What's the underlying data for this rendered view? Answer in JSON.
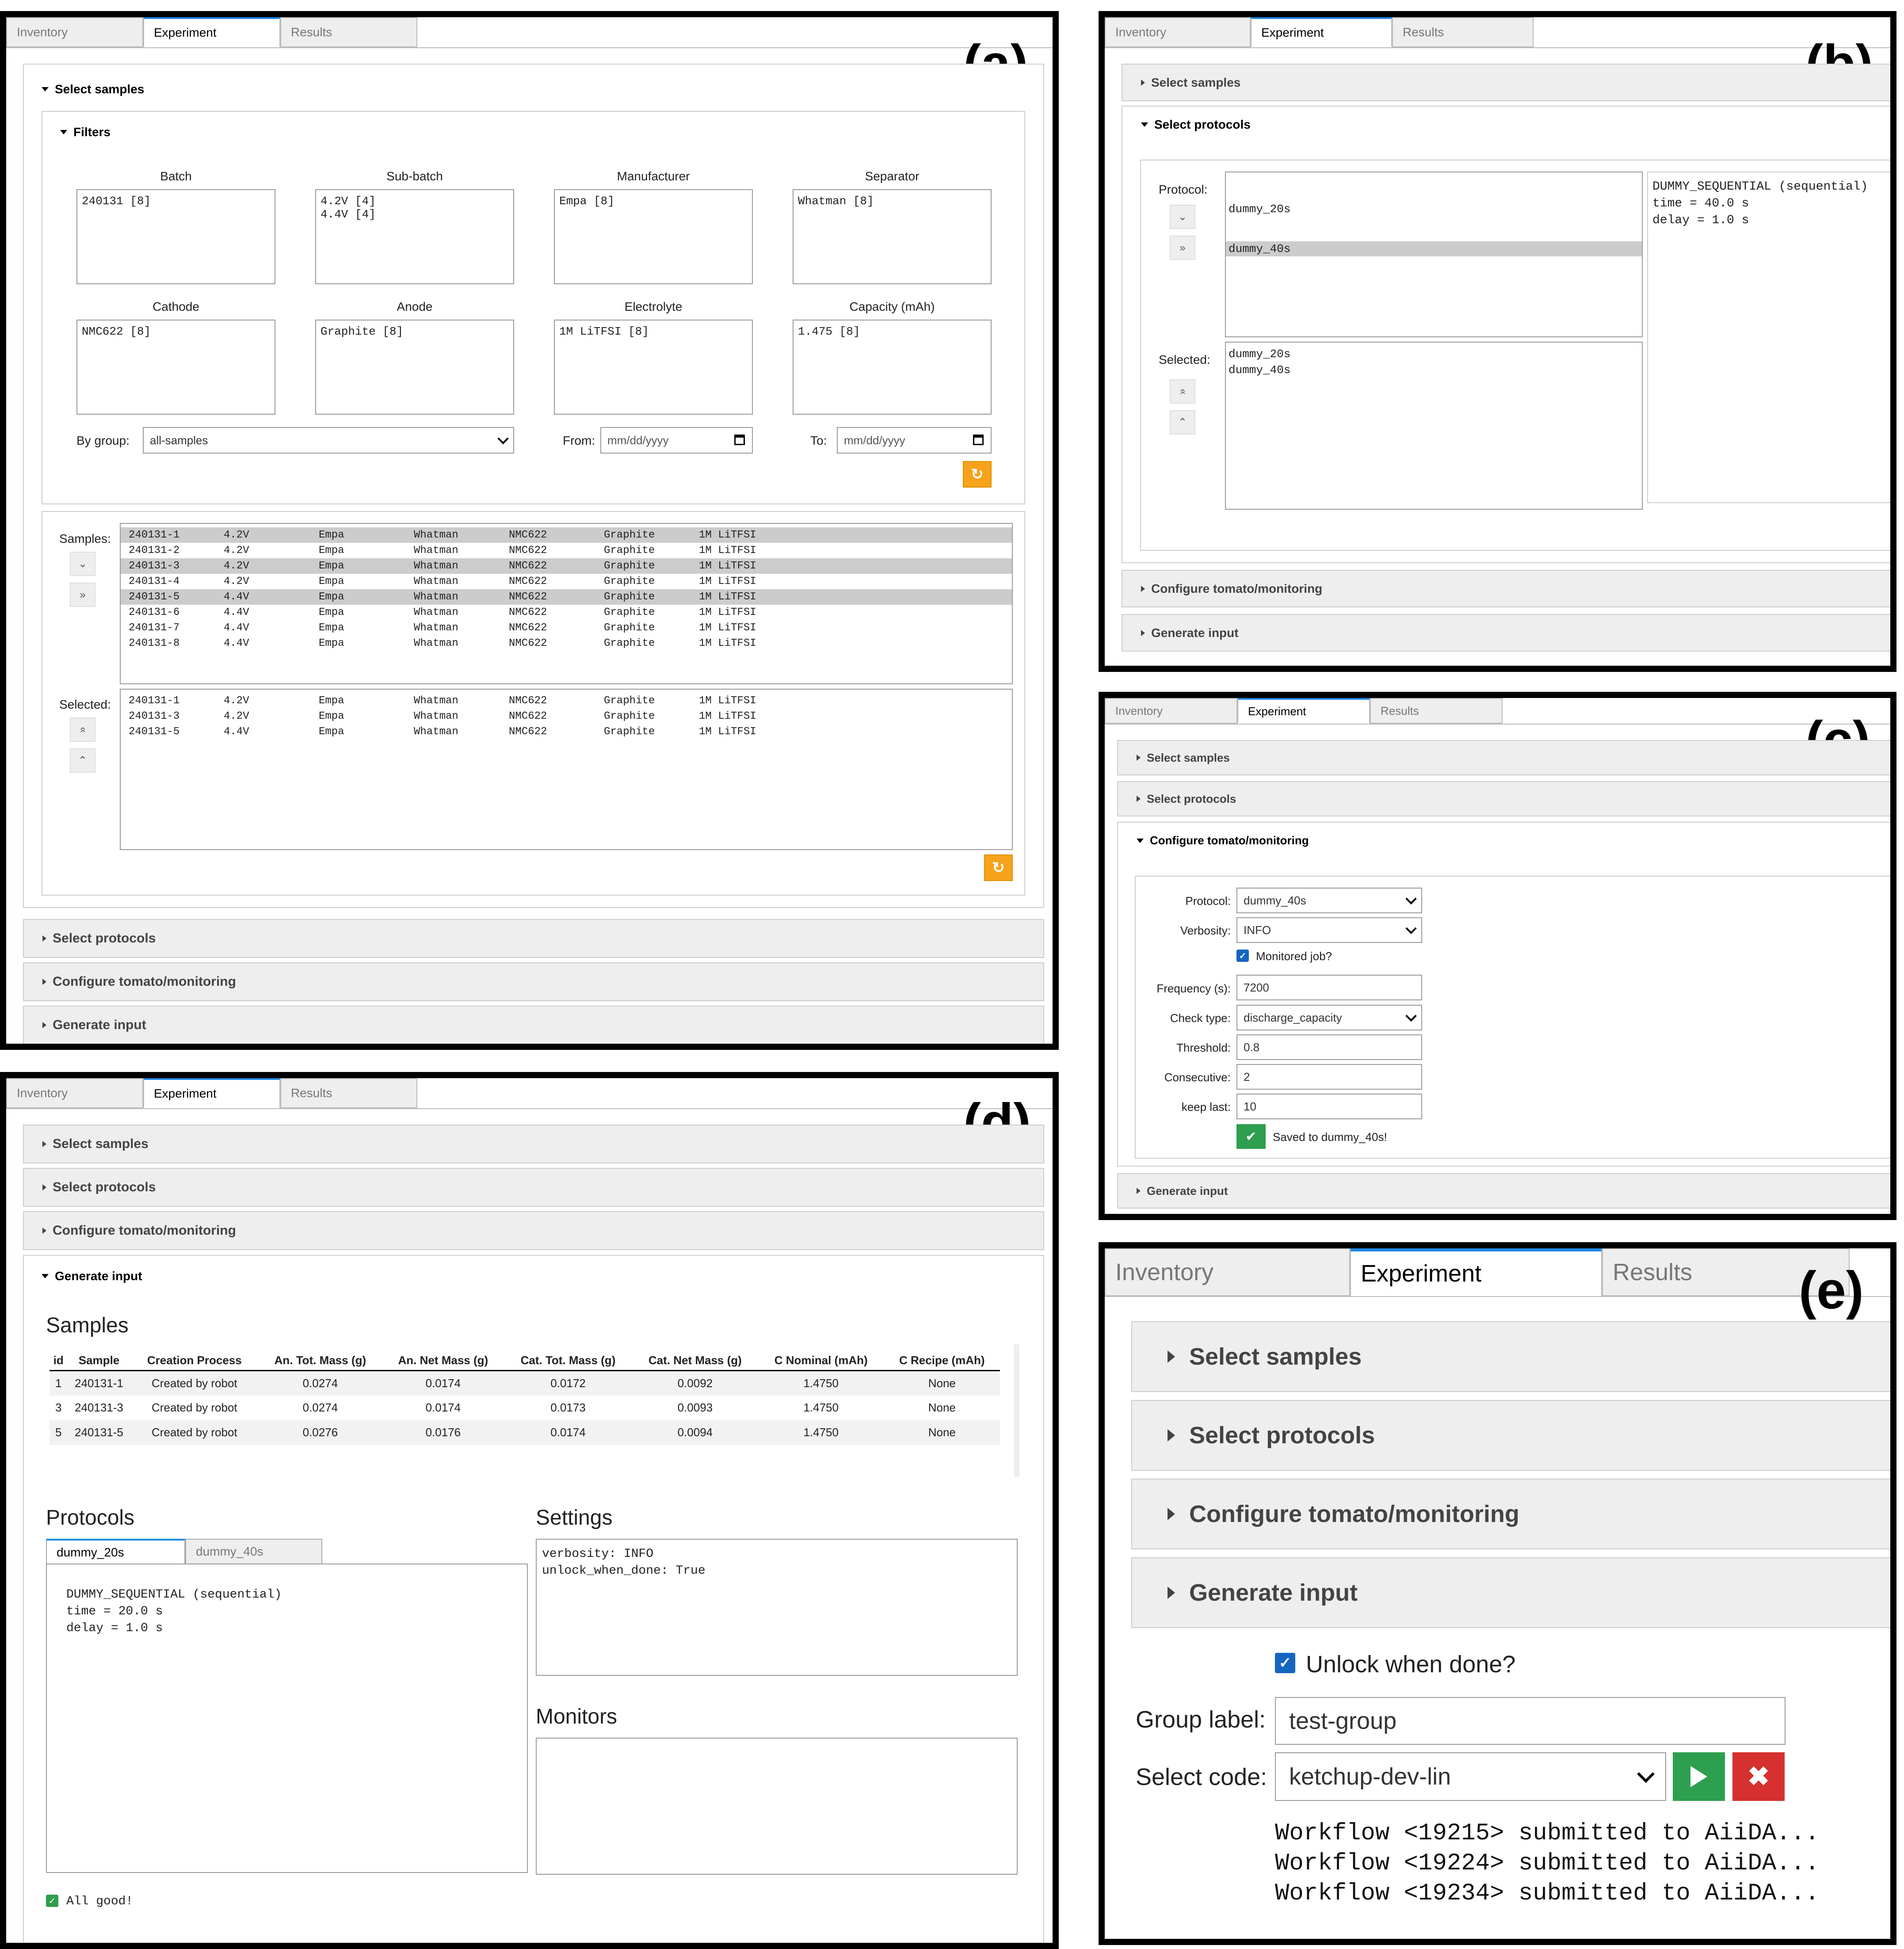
{
  "tabs": {
    "inventory": "Inventory",
    "experiment": "Experiment",
    "results": "Results"
  },
  "panels": {
    "a": "(a)",
    "b": "(b)",
    "c": "(c)",
    "d": "(d)",
    "e": "(e)"
  },
  "accordions": {
    "select_samples": "Select samples",
    "filters": "Filters",
    "select_protocols": "Select protocols",
    "configure": "Configure tomato/monitoring",
    "generate": "Generate input"
  },
  "filters": {
    "batch": {
      "label": "Batch",
      "values": "240131 [8]"
    },
    "subbatch": {
      "label": "Sub-batch",
      "values": "4.2V [4]\n4.4V [4]"
    },
    "manufacturer": {
      "label": "Manufacturer",
      "values": "Empa [8]"
    },
    "separator": {
      "label": "Separator",
      "values": "Whatman [8]"
    },
    "cathode": {
      "label": "Cathode",
      "values": "NMC622 [8]"
    },
    "anode": {
      "label": "Anode",
      "values": "Graphite [8]"
    },
    "electrolyte": {
      "label": "Electrolyte",
      "values": "1M LiTFSI [8]"
    },
    "capacity": {
      "label": "Capacity (mAh)",
      "values": "1.475 [8]"
    },
    "by_group_label": "By group:",
    "by_group_value": "all-samples",
    "from_label": "From:",
    "to_label": "To:",
    "date_placeholder": "mm/dd/yyyy"
  },
  "samples": {
    "samples_label": "Samples:",
    "selected_label": "Selected:",
    "rows": [
      [
        "240131-1",
        "4.2V",
        "Empa",
        "Whatman",
        "NMC622",
        "Graphite",
        "1M LiTFSI"
      ],
      [
        "240131-2",
        "4.2V",
        "Empa",
        "Whatman",
        "NMC622",
        "Graphite",
        "1M LiTFSI"
      ],
      [
        "240131-3",
        "4.2V",
        "Empa",
        "Whatman",
        "NMC622",
        "Graphite",
        "1M LiTFSI"
      ],
      [
        "240131-4",
        "4.2V",
        "Empa",
        "Whatman",
        "NMC622",
        "Graphite",
        "1M LiTFSI"
      ],
      [
        "240131-5",
        "4.4V",
        "Empa",
        "Whatman",
        "NMC622",
        "Graphite",
        "1M LiTFSI"
      ],
      [
        "240131-6",
        "4.4V",
        "Empa",
        "Whatman",
        "NMC622",
        "Graphite",
        "1M LiTFSI"
      ],
      [
        "240131-7",
        "4.4V",
        "Empa",
        "Whatman",
        "NMC622",
        "Graphite",
        "1M LiTFSI"
      ],
      [
        "240131-8",
        "4.4V",
        "Empa",
        "Whatman",
        "NMC622",
        "Graphite",
        "1M LiTFSI"
      ]
    ],
    "highlighted": [
      0,
      2,
      4
    ],
    "selected_rows": [
      [
        "240131-1",
        "4.2V",
        "Empa",
        "Whatman",
        "NMC622",
        "Graphite",
        "1M LiTFSI"
      ],
      [
        "240131-3",
        "4.2V",
        "Empa",
        "Whatman",
        "NMC622",
        "Graphite",
        "1M LiTFSI"
      ],
      [
        "240131-5",
        "4.4V",
        "Empa",
        "Whatman",
        "NMC622",
        "Graphite",
        "1M LiTFSI"
      ]
    ]
  },
  "protocols": {
    "protocol_label": "Protocol:",
    "selected_label": "Selected:",
    "list": "dummy_20s",
    "list_highlight": "dummy_40s",
    "selected_list": "dummy_20s\ndummy_40s",
    "detail": "DUMMY_SEQUENTIAL (sequential)\ntime = 40.0 s\ndelay = 1.0 s"
  },
  "configure": {
    "protocol_label": "Protocol:",
    "protocol_value": "dummy_40s",
    "verbosity_label": "Verbosity:",
    "verbosity_value": "INFO",
    "monitored_label": "Monitored job?",
    "frequency_label": "Frequency (s):",
    "frequency_value": "7200",
    "check_label": "Check type:",
    "check_value": "discharge_capacity",
    "threshold_label": "Threshold:",
    "threshold_value": "0.8",
    "consecutive_label": "Consecutive:",
    "consecutive_value": "2",
    "keep_label": "keep last:",
    "keep_value": "10",
    "saved": "Saved to dummy_40s!"
  },
  "generate": {
    "samples_heading": "Samples",
    "columns": [
      "id",
      "Sample",
      "Creation Process",
      "An. Tot. Mass (g)",
      "An. Net Mass (g)",
      "Cat. Tot. Mass (g)",
      "Cat. Net Mass (g)",
      "C Nominal (mAh)",
      "C Recipe (mAh)"
    ],
    "rows": [
      [
        "1",
        "240131-1",
        "Created by robot",
        "0.0274",
        "0.0174",
        "0.0172",
        "0.0092",
        "1.4750",
        "None"
      ],
      [
        "3",
        "240131-3",
        "Created by robot",
        "0.0274",
        "0.0174",
        "0.0173",
        "0.0093",
        "1.4750",
        "None"
      ],
      [
        "5",
        "240131-5",
        "Created by robot",
        "0.0276",
        "0.0176",
        "0.0174",
        "0.0094",
        "1.4750",
        "None"
      ]
    ],
    "protocols_heading": "Protocols",
    "settings_heading": "Settings",
    "monitors_heading": "Monitors",
    "ptab1": "dummy_20s",
    "ptab2": "dummy_40s",
    "protocol_detail": "DUMMY_SEQUENTIAL (sequential)\ntime = 20.0 s\ndelay = 1.0 s",
    "settings": "verbosity: INFO\nunlock_when_done: True",
    "status": "All good!"
  },
  "submit": {
    "unlock_label": "Unlock when done?",
    "group_label": "Group label:",
    "group_value": "test-group",
    "code_label": "Select code:",
    "code_value": "ketchup-dev-lin",
    "log": [
      "Workflow <19215> submitted to AiiDA...",
      "Workflow <19224> submitted to AiiDA...",
      "Workflow <19234> submitted to AiiDA..."
    ]
  },
  "colors": {
    "accent": "#1e88e5",
    "orange": "#f7a21b",
    "green": "#2e9e4f",
    "red": "#d63030"
  },
  "icons": [
    "refresh-icon",
    "chevron-down-icon",
    "double-chevron-down-icon",
    "chevron-up-icon",
    "double-chevron-up-icon",
    "calendar-icon",
    "check-icon",
    "play-icon",
    "close-icon"
  ]
}
